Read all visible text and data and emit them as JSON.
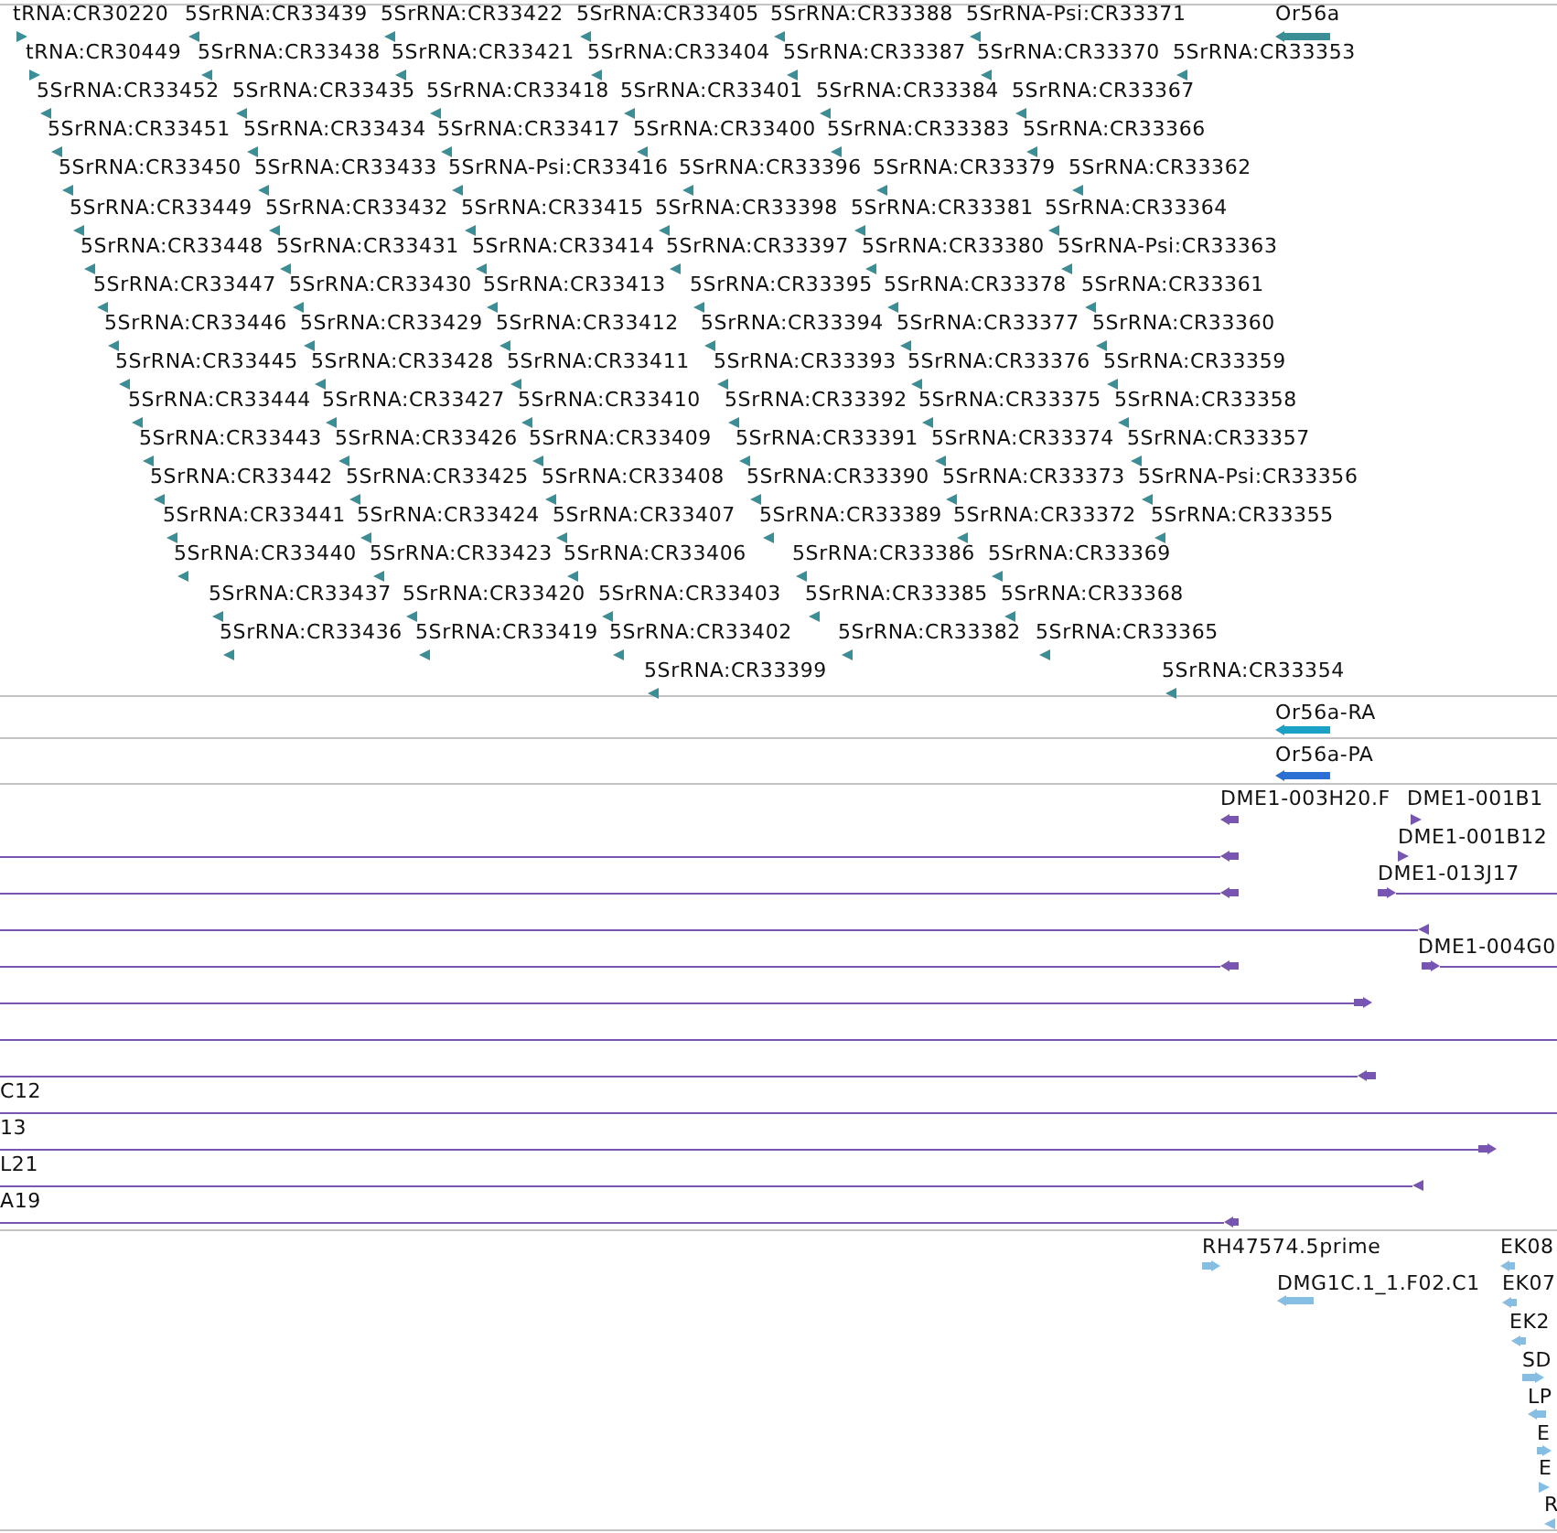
{
  "tracks": [
    {
      "color": "#3b8e96",
      "features": [
        {
          "label": "tRNA:CR30220",
          "reverse": false
        },
        {
          "label": "5SrRNA:CR33439",
          "reverse": true
        },
        {
          "label": "5SrRNA:CR33422",
          "reverse": true
        },
        {
          "label": "5SrRNA:CR33405",
          "reverse": true
        },
        {
          "label": "5SrRNA:CR33388",
          "reverse": true
        },
        {
          "label": "5SrRNA-Psi:CR33371",
          "reverse": true
        },
        {
          "label": "Or56a",
          "reverse": true
        },
        {
          "label": "tRNA:CR30449",
          "reverse": false
        },
        {
          "label": "5SrRNA:CR33438",
          "reverse": true
        },
        {
          "label": "5SrRNA:CR33421",
          "reverse": true
        },
        {
          "label": "5SrRNA:CR33404",
          "reverse": true
        },
        {
          "label": "5SrRNA:CR33387",
          "reverse": true
        },
        {
          "label": "5SrRNA:CR33370",
          "reverse": true
        },
        {
          "label": "5SrRNA:CR33353",
          "reverse": true
        },
        {
          "label": "5SrRNA:CR33452",
          "reverse": true
        },
        {
          "label": "5SrRNA:CR33435",
          "reverse": true
        },
        {
          "label": "5SrRNA:CR33418",
          "reverse": true
        },
        {
          "label": "5SrRNA:CR33401",
          "reverse": true
        },
        {
          "label": "5SrRNA:CR33384",
          "reverse": true
        },
        {
          "label": "5SrRNA:CR33367",
          "reverse": true
        },
        {
          "label": "5SrRNA:CR33451",
          "reverse": true
        },
        {
          "label": "5SrRNA:CR33434",
          "reverse": true
        },
        {
          "label": "5SrRNA:CR33417",
          "reverse": true
        },
        {
          "label": "5SrRNA:CR33400",
          "reverse": true
        },
        {
          "label": "5SrRNA:CR33383",
          "reverse": true
        },
        {
          "label": "5SrRNA:CR33366",
          "reverse": true
        },
        {
          "label": "5SrRNA:CR33450",
          "reverse": true
        },
        {
          "label": "5SrRNA:CR33433",
          "reverse": true
        },
        {
          "label": "5SrRNA-Psi:CR33416",
          "reverse": true
        },
        {
          "label": "5SrRNA:CR33396",
          "reverse": true
        },
        {
          "label": "5SrRNA:CR33379",
          "reverse": true
        },
        {
          "label": "5SrRNA:CR33362",
          "reverse": true
        },
        {
          "label": "5SrRNA:CR33449",
          "reverse": true
        },
        {
          "label": "5SrRNA:CR33432",
          "reverse": true
        },
        {
          "label": "5SrRNA:CR33415",
          "reverse": true
        },
        {
          "label": "5SrRNA:CR33398",
          "reverse": true
        },
        {
          "label": "5SrRNA:CR33381",
          "reverse": true
        },
        {
          "label": "5SrRNA:CR33364",
          "reverse": true
        },
        {
          "label": "5SrRNA:CR33448",
          "reverse": true
        },
        {
          "label": "5SrRNA:CR33431",
          "reverse": true
        },
        {
          "label": "5SrRNA:CR33414",
          "reverse": true
        },
        {
          "label": "5SrRNA:CR33397",
          "reverse": true
        },
        {
          "label": "5SrRNA:CR33380",
          "reverse": true
        },
        {
          "label": "5SrRNA-Psi:CR33363",
          "reverse": true
        },
        {
          "label": "5SrRNA:CR33447",
          "reverse": true
        },
        {
          "label": "5SrRNA:CR33430",
          "reverse": true
        },
        {
          "label": "5SrRNA:CR33413",
          "reverse": true
        },
        {
          "label": "5SrRNA:CR33395",
          "reverse": true
        },
        {
          "label": "5SrRNA:CR33378",
          "reverse": true
        },
        {
          "label": "5SrRNA:CR33361",
          "reverse": true
        },
        {
          "label": "5SrRNA:CR33446",
          "reverse": true
        },
        {
          "label": "5SrRNA:CR33429",
          "reverse": true
        },
        {
          "label": "5SrRNA:CR33412",
          "reverse": true
        },
        {
          "label": "5SrRNA:CR33394",
          "reverse": true
        },
        {
          "label": "5SrRNA:CR33377",
          "reverse": true
        },
        {
          "label": "5SrRNA:CR33360",
          "reverse": true
        },
        {
          "label": "5SrRNA:CR33445",
          "reverse": true
        },
        {
          "label": "5SrRNA:CR33428",
          "reverse": true
        },
        {
          "label": "5SrRNA:CR33411",
          "reverse": true
        },
        {
          "label": "5SrRNA:CR33393",
          "reverse": true
        },
        {
          "label": "5SrRNA:CR33376",
          "reverse": true
        },
        {
          "label": "5SrRNA:CR33359",
          "reverse": true
        },
        {
          "label": "5SrRNA:CR33444",
          "reverse": true
        },
        {
          "label": "5SrRNA:CR33427",
          "reverse": true
        },
        {
          "label": "5SrRNA:CR33410",
          "reverse": true
        },
        {
          "label": "5SrRNA:CR33392",
          "reverse": true
        },
        {
          "label": "5SrRNA:CR33375",
          "reverse": true
        },
        {
          "label": "5SrRNA:CR33358",
          "reverse": true
        },
        {
          "label": "5SrRNA:CR33443",
          "reverse": true
        },
        {
          "label": "5SrRNA:CR33426",
          "reverse": true
        },
        {
          "label": "5SrRNA:CR33409",
          "reverse": true
        },
        {
          "label": "5SrRNA:CR33391",
          "reverse": true
        },
        {
          "label": "5SrRNA:CR33374",
          "reverse": true
        },
        {
          "label": "5SrRNA:CR33357",
          "reverse": true
        },
        {
          "label": "5SrRNA:CR33442",
          "reverse": true
        },
        {
          "label": "5SrRNA:CR33425",
          "reverse": true
        },
        {
          "label": "5SrRNA:CR33408",
          "reverse": true
        },
        {
          "label": "5SrRNA:CR33390",
          "reverse": true
        },
        {
          "label": "5SrRNA:CR33373",
          "reverse": true
        },
        {
          "label": "5SrRNA-Psi:CR33356",
          "reverse": true
        },
        {
          "label": "5SrRNA:CR33441",
          "reverse": true
        },
        {
          "label": "5SrRNA:CR33424",
          "reverse": true
        },
        {
          "label": "5SrRNA:CR33407",
          "reverse": true
        },
        {
          "label": "5SrRNA:CR33389",
          "reverse": true
        },
        {
          "label": "5SrRNA:CR33372",
          "reverse": true
        },
        {
          "label": "5SrRNA:CR33355",
          "reverse": true
        },
        {
          "label": "5SrRNA:CR33440",
          "reverse": true
        },
        {
          "label": "5SrRNA:CR33423",
          "reverse": true
        },
        {
          "label": "5SrRNA:CR33406",
          "reverse": true
        },
        {
          "label": "5SrRNA:CR33386",
          "reverse": true
        },
        {
          "label": "5SrRNA:CR33369",
          "reverse": true
        },
        {
          "label": "5SrRNA:CR33437",
          "reverse": true
        },
        {
          "label": "5SrRNA:CR33420",
          "reverse": true
        },
        {
          "label": "5SrRNA:CR33403",
          "reverse": true
        },
        {
          "label": "5SrRNA:CR33385",
          "reverse": true
        },
        {
          "label": "5SrRNA:CR33368",
          "reverse": true
        },
        {
          "label": "5SrRNA:CR33436",
          "reverse": true
        },
        {
          "label": "5SrRNA:CR33419",
          "reverse": true
        },
        {
          "label": "5SrRNA:CR33402",
          "reverse": true
        },
        {
          "label": "5SrRNA:CR33382",
          "reverse": true
        },
        {
          "label": "5SrRNA:CR33365",
          "reverse": true
        },
        {
          "label": "5SrRNA:CR33399",
          "reverse": true
        },
        {
          "label": "5SrRNA:CR33354",
          "reverse": true
        }
      ]
    },
    {
      "color": "#1ba1c6",
      "features": [
        {
          "label": "Or56a-RA",
          "reverse": true
        }
      ]
    },
    {
      "color": "#2c6fd2",
      "features": [
        {
          "label": "Or56a-PA",
          "reverse": true
        }
      ]
    },
    {
      "color": "#7755b0",
      "features": [
        {
          "label": "DME1-003H20.F",
          "reverse": true
        },
        {
          "label": "DME1-001B1",
          "reverse": false
        },
        {
          "label": "DME1-001B12",
          "reverse": false
        },
        {
          "reverse": true
        },
        {
          "label": "DME1-013J17",
          "reverse": false
        },
        {
          "reverse": true
        },
        {
          "reverse": true
        },
        {
          "label": "DME1-004G0",
          "reverse": false
        },
        {
          "reverse": true
        },
        {
          "reverse": false
        },
        {
          "reverse": true
        },
        {
          "label": "C12"
        },
        {
          "label": "13",
          "reverse": false
        },
        {
          "label": "L21",
          "reverse": true
        },
        {
          "label": "A19",
          "reverse": true
        }
      ]
    },
    {
      "color": "#86bde3",
      "features": [
        {
          "label": "RH47574.5prime",
          "reverse": false
        },
        {
          "label": "EK08",
          "reverse": true
        },
        {
          "label": "DMG1C.1_1.F02.C1",
          "reverse": true
        },
        {
          "label": "EK07",
          "reverse": true
        },
        {
          "label": "EK2",
          "reverse": true
        },
        {
          "label": "SD",
          "reverse": false
        },
        {
          "label": "LP",
          "reverse": true
        },
        {
          "label": "E",
          "reverse": false
        },
        {
          "label": "E",
          "reverse": false
        },
        {
          "label": "R",
          "reverse": true
        }
      ]
    }
  ]
}
